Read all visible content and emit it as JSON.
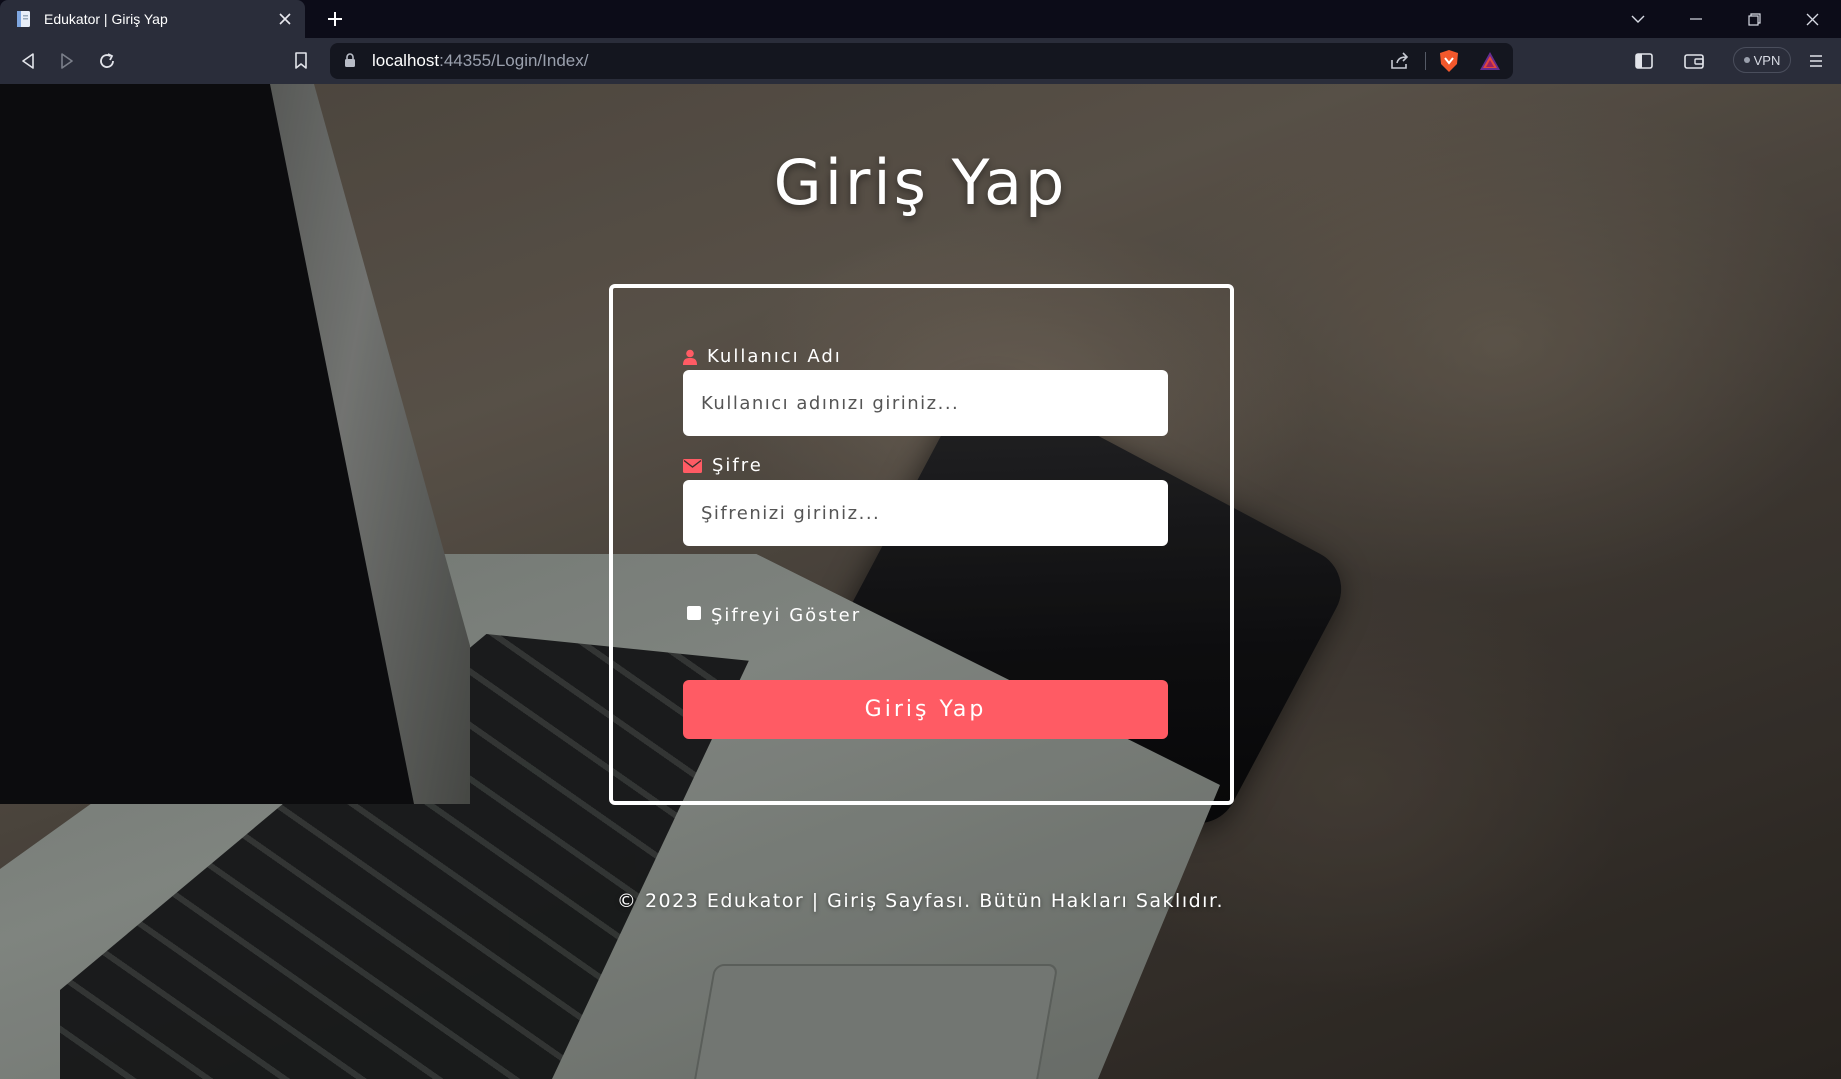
{
  "browser": {
    "tab_title": "Edukator | Giriş Yap",
    "url_host": "localhost",
    "url_rest": ":44355/Login/Index/",
    "vpn_label": "VPN",
    "icons": [
      "back-icon",
      "forward-icon",
      "reload-icon",
      "bookmark-icon",
      "lock-icon",
      "share-icon",
      "brave-shields-icon",
      "brave-rewards-icon",
      "sidebar-icon",
      "wallet-icon",
      "menu-icon"
    ]
  },
  "login": {
    "title": "Giriş Yap",
    "username_label": "Kullanıcı Adı",
    "username_placeholder": "Kullanıcı adınızı giriniz...",
    "password_label": "Şifre",
    "password_placeholder": "Şifrenizi giriniz...",
    "show_password_label": "Şifreyi Göster",
    "show_password_checked": false,
    "submit_label": "Giriş Yap"
  },
  "footer": {
    "text": "© 2023 Edukator | Giriş Sayfası. Bütün Hakları Saklıdır."
  },
  "colors": {
    "accent": "#ff5b64",
    "icon_accent": "#ff5b64",
    "tab_bg": "#2a2d3a",
    "titlebar_bg": "#0c0c18"
  }
}
